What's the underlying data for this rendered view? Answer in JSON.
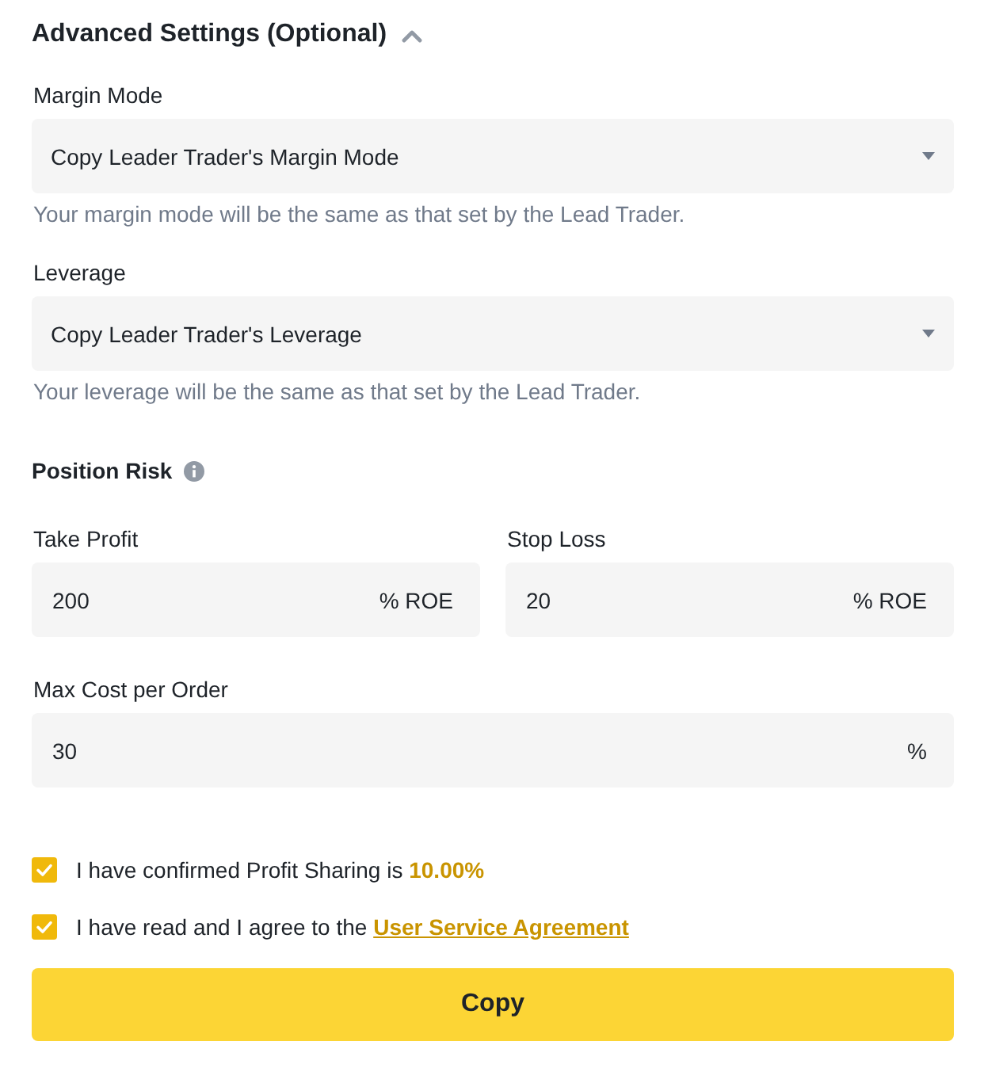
{
  "section": {
    "title": "Advanced Settings (Optional)",
    "expanded": true
  },
  "selects": [
    {
      "label": "Margin Mode",
      "value": "Copy Leader Trader's Margin Mode",
      "hint": "Your margin mode will be the same as that set by the Lead Trader."
    },
    {
      "label": "Leverage",
      "value": "Copy Leader Trader's Leverage",
      "hint": "Your leverage will be the same as that set by the Lead Trader."
    }
  ],
  "position_risk": {
    "title": "Position Risk",
    "inputs": [
      {
        "label": "Take Profit",
        "value": "200",
        "unit": "% ROE"
      },
      {
        "label": "Stop Loss",
        "value": "20",
        "unit": "% ROE"
      }
    ],
    "max_cost": {
      "label": "Max Cost per Order",
      "value": "30",
      "unit": "%"
    }
  },
  "agreements": [
    {
      "text": "I have confirmed Profit Sharing is **10.00%**",
      "checked": true
    },
    {
      "text": "I have read and I agree to the",
      "link": "User Service Agreement",
      "checked": true
    }
  ],
  "button": {
    "label": "Copy"
  }
}
